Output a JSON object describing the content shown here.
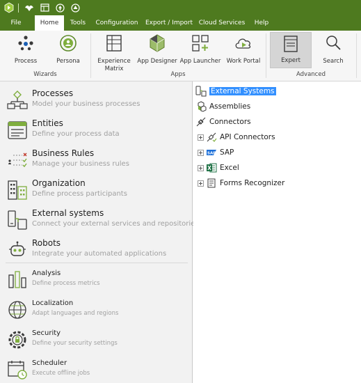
{
  "colors": {
    "titlebar": "#4e7a1f",
    "accent": "#4e7a1f",
    "selection": "#3390ff",
    "subtitle": "#a0a0a0"
  },
  "menu": {
    "tabs": [
      {
        "label": "File"
      },
      {
        "label": "Home"
      },
      {
        "label": "Tools"
      },
      {
        "label": "Configuration"
      },
      {
        "label": "Export / Import"
      },
      {
        "label": "Cloud Services"
      },
      {
        "label": "Help"
      }
    ],
    "active": "Home"
  },
  "ribbon": {
    "buttons": [
      {
        "label": "Process",
        "icon": "process-icon"
      },
      {
        "label": "Persona",
        "icon": "persona-icon"
      },
      {
        "label": "Experience",
        "label2": "Matrix",
        "icon": "experience-matrix-icon"
      },
      {
        "label": "App Designer",
        "icon": "app-designer-icon"
      },
      {
        "label": "App Launcher",
        "icon": "app-launcher-icon"
      },
      {
        "label": "Work Portal",
        "icon": "work-portal-icon"
      },
      {
        "label": "Expert",
        "icon": "expert-icon",
        "selected": true
      },
      {
        "label": "Search",
        "icon": "search-icon"
      }
    ],
    "groups": [
      {
        "label": "Wizards"
      },
      {
        "label": "Apps"
      },
      {
        "label": "Advanced"
      }
    ]
  },
  "nav": {
    "items": [
      {
        "title": "Processes",
        "subtitle": "Model your business processes",
        "icon": "processes-icon"
      },
      {
        "title": "Entities",
        "subtitle": "Define your process data",
        "icon": "entities-icon"
      },
      {
        "title": "Business Rules",
        "subtitle": "Manage your business rules",
        "icon": "business-rules-icon"
      },
      {
        "title": "Organization",
        "subtitle": "Define process participants",
        "icon": "organization-icon"
      },
      {
        "title": "External systems",
        "subtitle": "Connect your external services and repositories",
        "icon": "external-systems-icon"
      },
      {
        "title": "Robots",
        "subtitle": "Integrate your automated applications",
        "icon": "robots-icon"
      },
      {
        "title": "Analysis",
        "subtitle": "Define process metrics",
        "icon": "analysis-icon"
      },
      {
        "title": "Localization",
        "subtitle": "Adapt languages and regions",
        "icon": "localization-icon"
      },
      {
        "title": "Security",
        "subtitle": "Define your security settings",
        "icon": "security-icon"
      },
      {
        "title": "Scheduler",
        "subtitle": "Execute offline jobs",
        "icon": "scheduler-icon"
      }
    ]
  },
  "tree": {
    "nodes": [
      {
        "label": "External Systems",
        "icon": "external-systems-icon",
        "selected": true
      },
      {
        "label": "Assemblies",
        "icon": "assemblies-icon"
      },
      {
        "label": "Connectors",
        "icon": "connectors-icon"
      },
      {
        "label": "API Connectors",
        "icon": "api-connectors-icon",
        "expandable": true
      },
      {
        "label": "SAP",
        "icon": "sap-icon",
        "expandable": true
      },
      {
        "label": "Excel",
        "icon": "excel-icon",
        "expandable": true
      },
      {
        "label": "Forms Recognizer",
        "icon": "forms-recognizer-icon",
        "expandable": true
      }
    ]
  }
}
